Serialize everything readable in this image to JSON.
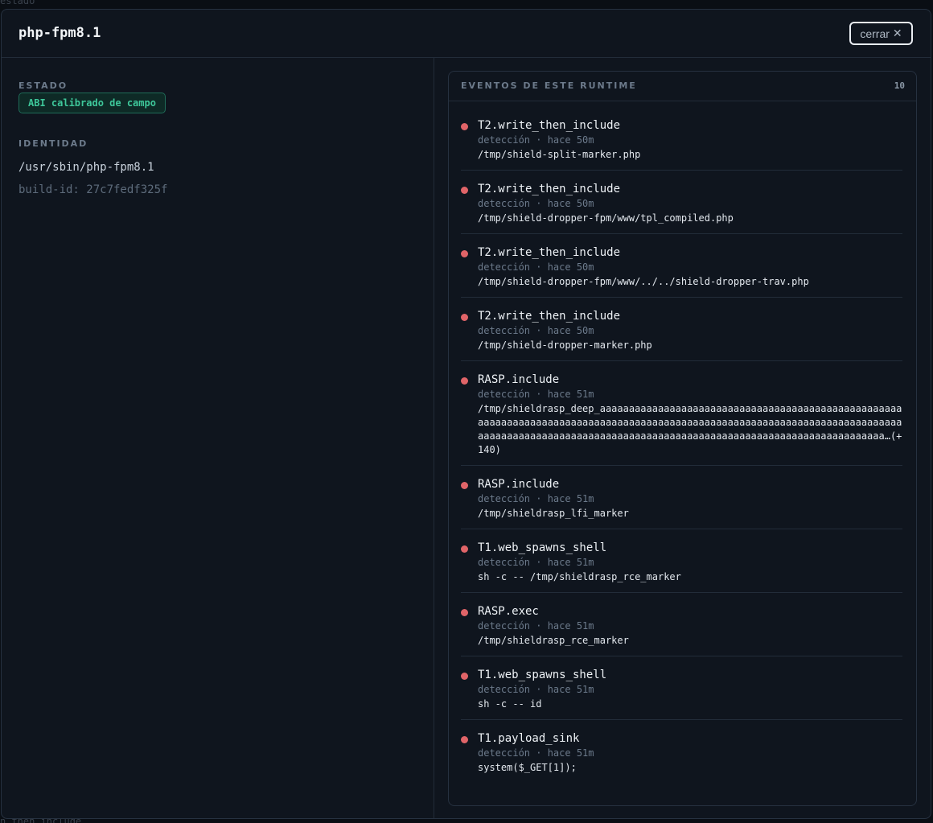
{
  "backdrop": {
    "top_text": "estado",
    "bottom_text": "n_then_include"
  },
  "modal": {
    "title": "php-fpm8.1",
    "close_label": "cerrar",
    "close_icon": "✕"
  },
  "left": {
    "estado_label": "ESTADO",
    "estado_badge": "ABI calibrado de campo",
    "identidad_label": "IDENTIDAD",
    "path": "/usr/sbin/php-fpm8.1",
    "build_id": "build-id: 27c7fedf325f"
  },
  "events_panel": {
    "title": "EVENTOS DE ESTE RUNTIME",
    "count": "10",
    "dot_color": "#e06468",
    "events": [
      {
        "name": "T2.write_then_include",
        "meta": "detección · hace 50m",
        "detail": "/tmp/shield-split-marker.php"
      },
      {
        "name": "T2.write_then_include",
        "meta": "detección · hace 50m",
        "detail": "/tmp/shield-dropper-fpm/www/tpl_compiled.php"
      },
      {
        "name": "T2.write_then_include",
        "meta": "detección · hace 50m",
        "detail": "/tmp/shield-dropper-fpm/www/../../shield-dropper-trav.php"
      },
      {
        "name": "T2.write_then_include",
        "meta": "detección · hace 50m",
        "detail": "/tmp/shield-dropper-marker.php"
      },
      {
        "name": "RASP.include",
        "meta": "detección · hace 51m",
        "detail": "/tmp/shieldrasp_deep_aaaaaaaaaaaaaaaaaaaaaaaaaaaaaaaaaaaaaaaaaaaaaaaaaaaaaaaaaaaaaaaaaaaaaaaaaaaaaaaaaaaaaaaaaaaaaaaaaaaaaaaaaaaaaaaaaaaaaaaaaaaaaaaaaaaaaaaaaaaaaaaaaaaaaaaaaaaaaaaaaaaaaaaaaaaaaaaaaaaaaaaaaaaaaaaaaaa…(+140)"
      },
      {
        "name": "RASP.include",
        "meta": "detección · hace 51m",
        "detail": "/tmp/shieldrasp_lfi_marker"
      },
      {
        "name": "T1.web_spawns_shell",
        "meta": "detección · hace 51m",
        "detail": "sh -c -- /tmp/shieldrasp_rce_marker"
      },
      {
        "name": "RASP.exec",
        "meta": "detección · hace 51m",
        "detail": "/tmp/shieldrasp_rce_marker"
      },
      {
        "name": "T1.web_spawns_shell",
        "meta": "detección · hace 51m",
        "detail": "sh -c -- id"
      },
      {
        "name": "T1.payload_sink",
        "meta": "detección · hace 51m",
        "detail": "system($_GET[1]);"
      }
    ]
  }
}
